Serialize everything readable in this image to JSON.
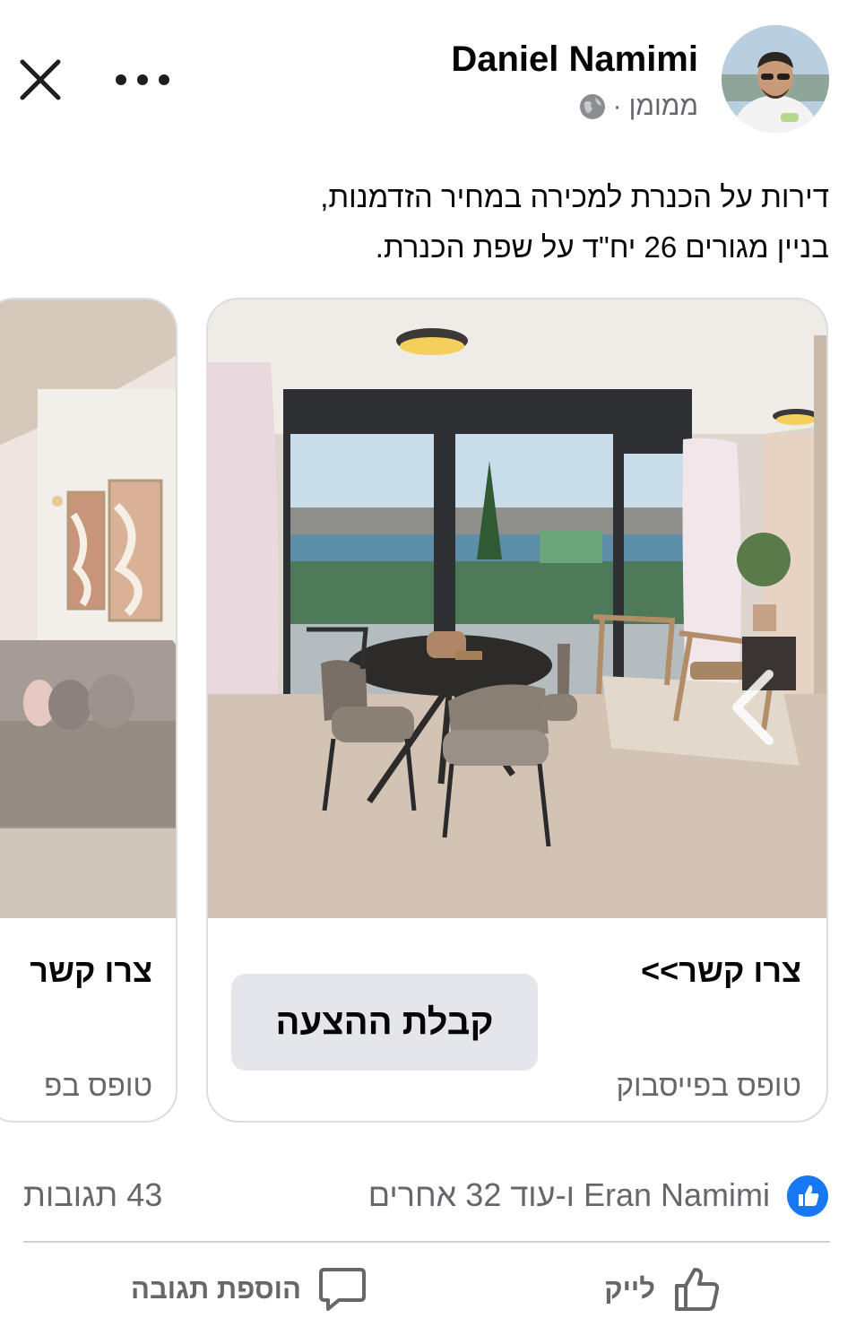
{
  "header": {
    "author_name": "Daniel Namimi",
    "sponsored_label": "ממומן",
    "separator": "·"
  },
  "post": {
    "text_lines": [
      "דירות על הכנרת למכירה במחיר הזדמנות,",
      "בניין מגורים 26 יח\"ד על שפת הכנרת."
    ]
  },
  "carousel": {
    "cards": [
      {
        "title": "צרו קשר>>",
        "cta": "קבלת ההצעה",
        "subtitle": "טופס בפייסבוק"
      },
      {
        "title": "צרו קשר",
        "subtitle": "טופס בפ"
      }
    ]
  },
  "reactions": {
    "names": "Eran Namimi ו-עוד 32 אחרים",
    "comments": "43 תגובות"
  },
  "actions": {
    "like": "לייק",
    "comment": "הוספת תגובה"
  },
  "colors": {
    "like_blue": "#1877f2",
    "secondary_text": "#65676b",
    "button_bg": "#e4e6eb"
  },
  "icons": [
    "close-icon",
    "more-icon",
    "globe-icon",
    "like-badge-icon",
    "thumbs-up-icon",
    "comment-icon",
    "chevron-left-icon"
  ]
}
